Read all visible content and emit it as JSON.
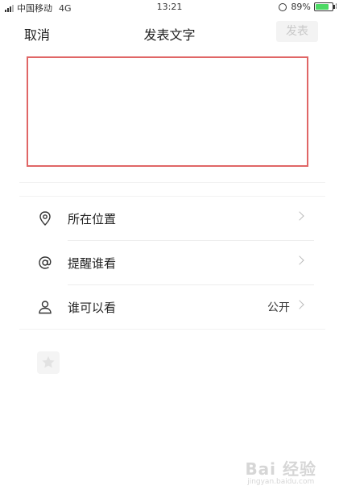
{
  "status_bar": {
    "carrier": "中国移动",
    "network": "4G",
    "time": "13:21",
    "battery": "89%",
    "battery_level": 0.89,
    "battery_color": "#4cd964"
  },
  "nav": {
    "cancel_label": "取消",
    "title": "发表文字",
    "publish_label": "发表"
  },
  "highlight_color": "#e06666",
  "options": [
    {
      "label": "所在位置",
      "value": "",
      "icon": "location-pin-icon"
    },
    {
      "label": "提醒谁看",
      "value": "",
      "icon": "at-sign-icon"
    },
    {
      "label": "谁可以看",
      "value": "公开",
      "icon": "person-icon"
    }
  ],
  "watermark": {
    "logo": "Bai 经验",
    "site": "jingyan.baidu.com"
  }
}
